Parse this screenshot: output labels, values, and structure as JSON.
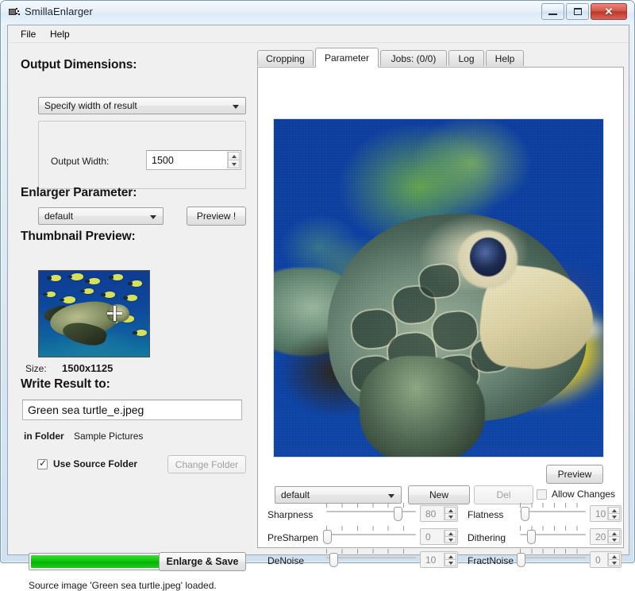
{
  "window": {
    "title": "SmillaEnlarger",
    "icon": "app-icon",
    "minimize_label": "Minimize",
    "maximize_label": "Maximize",
    "close_label": "✕"
  },
  "menu": {
    "items": [
      {
        "label": "File"
      },
      {
        "label": "Help"
      }
    ]
  },
  "left": {
    "output_dimensions": {
      "title": "Output Dimensions:",
      "mode_combo_value": "Specify width of result",
      "field_label": "Output Width:",
      "field_value": "1500"
    },
    "enlarger_parameter": {
      "title": "Enlarger Parameter:",
      "preset_combo_value": "default",
      "preview_button": "Preview !"
    },
    "thumbnail": {
      "title": "Thumbnail Preview:",
      "size_label": "Size:",
      "size_value": "1500x1125"
    },
    "write_result": {
      "title": "Write Result to:",
      "filename_value": "Green sea turtle_e.jpeg",
      "in_folder_label": "in Folder",
      "folder_value": "Sample Pictures",
      "use_source_folder_label": "Use Source Folder",
      "use_source_folder_checked": true,
      "change_folder_button": "Change Folder",
      "change_folder_enabled": false
    },
    "progress": {
      "percent": 100,
      "fill_color": "#0ac40a"
    },
    "enlarge_save_button": "Enlarge & Save",
    "status_text": "Source image 'Green sea turtle.jpeg' loaded."
  },
  "right": {
    "tabs": [
      {
        "label": "Cropping",
        "active": false
      },
      {
        "label": "Parameter",
        "active": true
      },
      {
        "label": "Jobs: (0/0)",
        "active": false
      },
      {
        "label": "Log",
        "active": false
      },
      {
        "label": "Help",
        "active": false
      }
    ],
    "preview_button": "Preview",
    "preset_combo_value": "default",
    "new_button": "New",
    "del_button": "Del",
    "del_enabled": false,
    "allow_changes_label": "Allow Changes",
    "allow_changes_checked": false,
    "params_left": [
      {
        "label": "Sharpness",
        "value": "80",
        "position": 80
      },
      {
        "label": "PreSharpen",
        "value": "0",
        "position": 0
      },
      {
        "label": "DeNoise",
        "value": "10",
        "position": 10
      }
    ],
    "params_right": [
      {
        "label": "Flatness",
        "value": "10",
        "position": 10
      },
      {
        "label": "Dithering",
        "value": "20",
        "position": 20
      },
      {
        "label": "FractNoise",
        "value": "0",
        "position": 0
      }
    ]
  }
}
